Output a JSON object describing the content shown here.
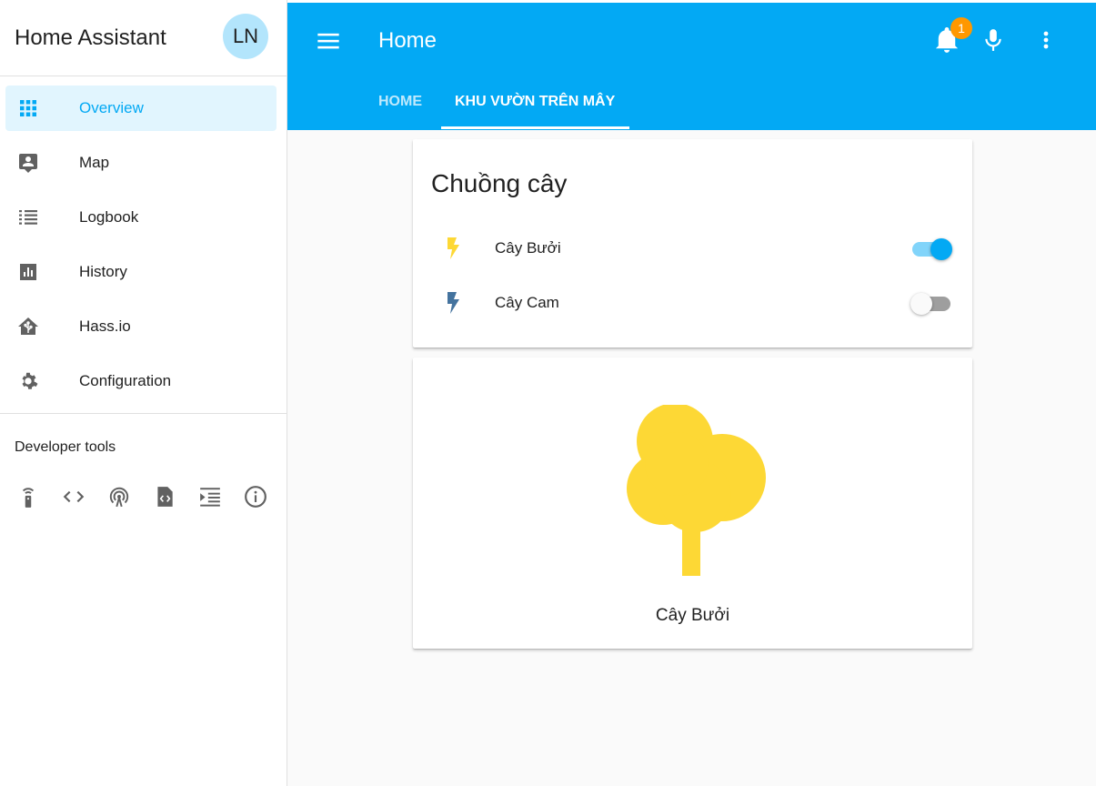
{
  "sidebar": {
    "title": "Home Assistant",
    "avatar_initials": "LN",
    "items": [
      {
        "label": "Overview",
        "icon": "view-dashboard-icon"
      },
      {
        "label": "Map",
        "icon": "account-location-icon"
      },
      {
        "label": "Logbook",
        "icon": "format-list-bulleted-icon"
      },
      {
        "label": "History",
        "icon": "chart-box-icon"
      },
      {
        "label": "Hass.io",
        "icon": "home-assistant-icon"
      },
      {
        "label": "Configuration",
        "icon": "settings-icon"
      }
    ],
    "developer_tools_title": "Developer tools",
    "developer_tools": [
      "remote-icon",
      "code-tags-icon",
      "access-point-icon",
      "file-code-icon",
      "format-indent-icon",
      "information-outline-icon"
    ]
  },
  "header": {
    "title": "Home",
    "notification_count": "1",
    "tabs": [
      {
        "label": "HOME"
      },
      {
        "label": "KHU VƯỜN TRÊN MÂY"
      }
    ],
    "active_tab": 1
  },
  "entities_card": {
    "title": "Chuồng cây",
    "entities": [
      {
        "name": "Cây Bưởi",
        "state": "on",
        "icon_color": "#fdd835"
      },
      {
        "name": "Cây Cam",
        "state": "off",
        "icon_color": "#44739e"
      }
    ]
  },
  "picture_card": {
    "label": "Cây Bưởi",
    "icon": "tree-icon",
    "icon_color": "#fdd835"
  },
  "colors": {
    "primary": "#03a9f4",
    "badge": "#ff9800",
    "active_bg": "#e1f5fe"
  }
}
